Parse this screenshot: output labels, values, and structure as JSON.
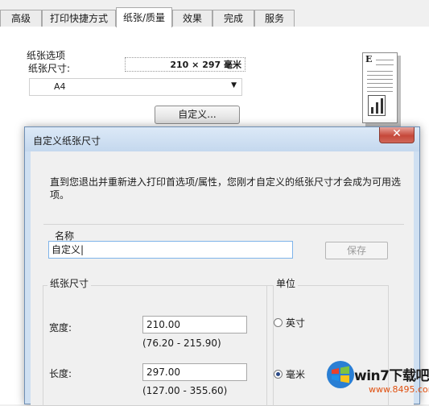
{
  "tabs": [
    {
      "label": "高级"
    },
    {
      "label": "打印快捷方式"
    },
    {
      "label": "纸张/质量"
    },
    {
      "label": "效果"
    },
    {
      "label": "完成"
    },
    {
      "label": "服务"
    }
  ],
  "paper_options": {
    "group_title": "纸张选项",
    "size_label": "纸张尺寸:",
    "size_value": "210 × 297 毫米",
    "selected_size": "A4",
    "custom_button": "自定义..."
  },
  "preview": {
    "letter": "E"
  },
  "dialog": {
    "title": "自定义纸张尺寸",
    "close_symbol": "✕",
    "notice": "直到您退出并重新进入打印首选项/属性，您刚才自定义的纸张尺寸才会成为可用选项。",
    "name_label": "名称",
    "name_value": "自定义|",
    "save_button": "保存",
    "size_group_title": "纸张尺寸",
    "width_label": "宽度:",
    "width_value": "210.00",
    "width_range": "(76.20 - 215.90)",
    "length_label": "长度:",
    "length_value": "297.00",
    "length_range": "(127.00 - 355.60)",
    "unit_group_title": "单位",
    "unit_inch": "英寸",
    "unit_mm": "毫米",
    "unit_selected": "毫米"
  },
  "watermark": {
    "brand": "win7下载吧",
    "url": "www.8495.com"
  }
}
